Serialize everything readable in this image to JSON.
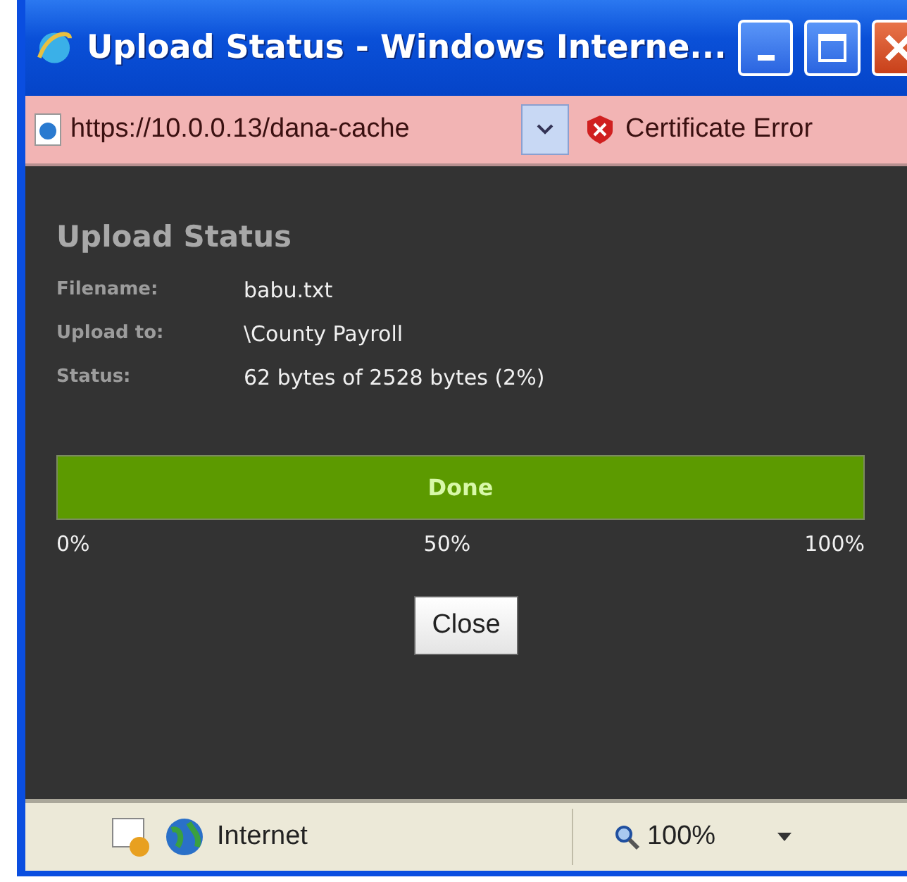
{
  "window": {
    "title": "Upload Status - Windows Interne..."
  },
  "address_bar": {
    "url": "https://10.0.0.13/dana-cache",
    "certificate": "Certificate Error"
  },
  "dialog": {
    "heading": "Upload Status",
    "fields": [
      {
        "label": "Filename:",
        "value": "babu.txt"
      },
      {
        "label": "Upload to:",
        "value": "\\County Payroll"
      },
      {
        "label": "Status:",
        "value": "62 bytes of 2528 bytes (2%)"
      }
    ],
    "progress": {
      "level": 1,
      "text": "Done",
      "ticks": [
        "0%",
        "50%",
        "100%"
      ]
    },
    "buttons": [
      "Close"
    ]
  },
  "status_bar": {
    "zone": "Internet",
    "zoom": "100%"
  }
}
